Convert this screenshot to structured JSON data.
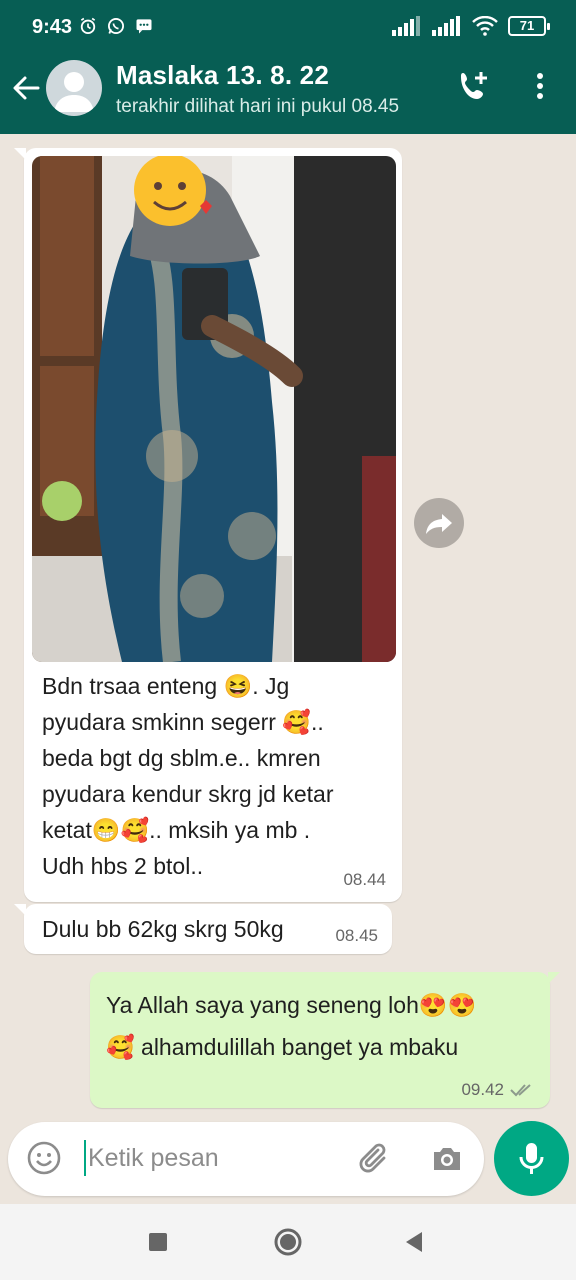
{
  "status_bar": {
    "time": "9:43",
    "battery": "71"
  },
  "header": {
    "contact_name": "Maslaka 13. 8. 22",
    "last_seen": "terakhir dilihat hari ini pukul 08.45"
  },
  "messages": [
    {
      "direction": "incoming",
      "has_image": true,
      "lines": [
        "Bdn trsaa enteng 😆. Jg",
        "pyudara smkinn segerr 🥰..",
        "beda bgt dg sblm.e.. kmren",
        "pyudara kendur skrg jd ketar",
        "ketat😁🥰.. mksih ya mb .",
        "Udh hbs 2 btol.."
      ],
      "time": "08.44"
    },
    {
      "direction": "incoming",
      "has_image": false,
      "lines": [
        "Dulu bb 62kg skrg 50kg"
      ],
      "time": "08.45"
    },
    {
      "direction": "outgoing",
      "has_image": false,
      "lines": [
        "Ya Allah saya yang seneng loh😍😍",
        "🥰 alhamdulillah banget ya mbaku"
      ],
      "time": "09.42"
    }
  ],
  "composer": {
    "placeholder": "Ketik pesan"
  },
  "colors": {
    "header": "#075e54",
    "accent": "#00a884",
    "chat_bg": "#ece5dd",
    "outgoing_bubble": "#dcf8c6",
    "incoming_bubble": "#ffffff"
  },
  "icons": [
    "arrow-back-icon",
    "add-call-icon",
    "more-vert-icon",
    "forward-icon",
    "emoji-icon",
    "attach-icon",
    "camera-icon",
    "mic-icon",
    "read-ticks-icon",
    "nav-square-icon",
    "nav-circle-icon",
    "nav-back-icon"
  ]
}
